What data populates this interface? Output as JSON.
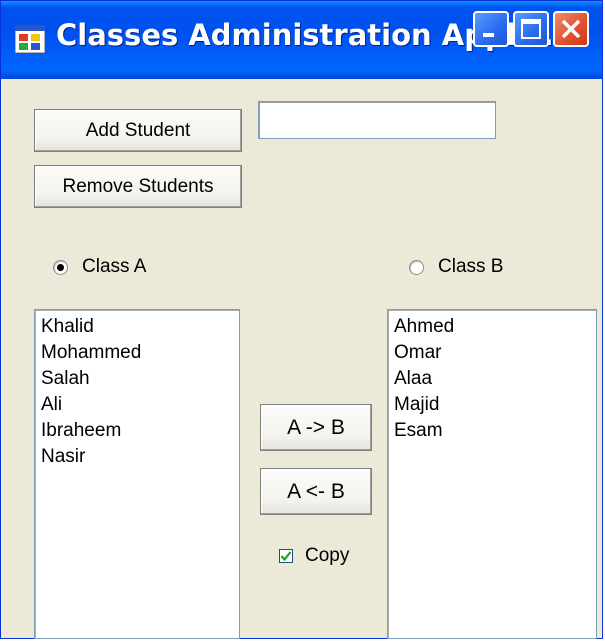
{
  "window": {
    "title": "Classes Administration Applic...",
    "controls": [
      "minimize-icon",
      "maximize-icon",
      "close-icon"
    ],
    "title_color": "#0055ea"
  },
  "toolbar": {
    "add_student_label": "Add Student",
    "remove_students_label": "Remove Students",
    "student_name_value": ""
  },
  "class_a": {
    "label": "Class A",
    "selected": true,
    "students": [
      "Khalid",
      "Mohammed",
      "Salah",
      "Ali",
      "Ibraheem",
      "Nasir"
    ]
  },
  "class_b": {
    "label": "Class B",
    "selected": false,
    "students": [
      "Ahmed",
      "Omar",
      "Alaa",
      "Majid",
      "Esam"
    ]
  },
  "transfer": {
    "a_to_b_label": "A -> B",
    "b_to_a_label": "A <- B",
    "copy_label": "Copy",
    "copy_checked": true
  }
}
